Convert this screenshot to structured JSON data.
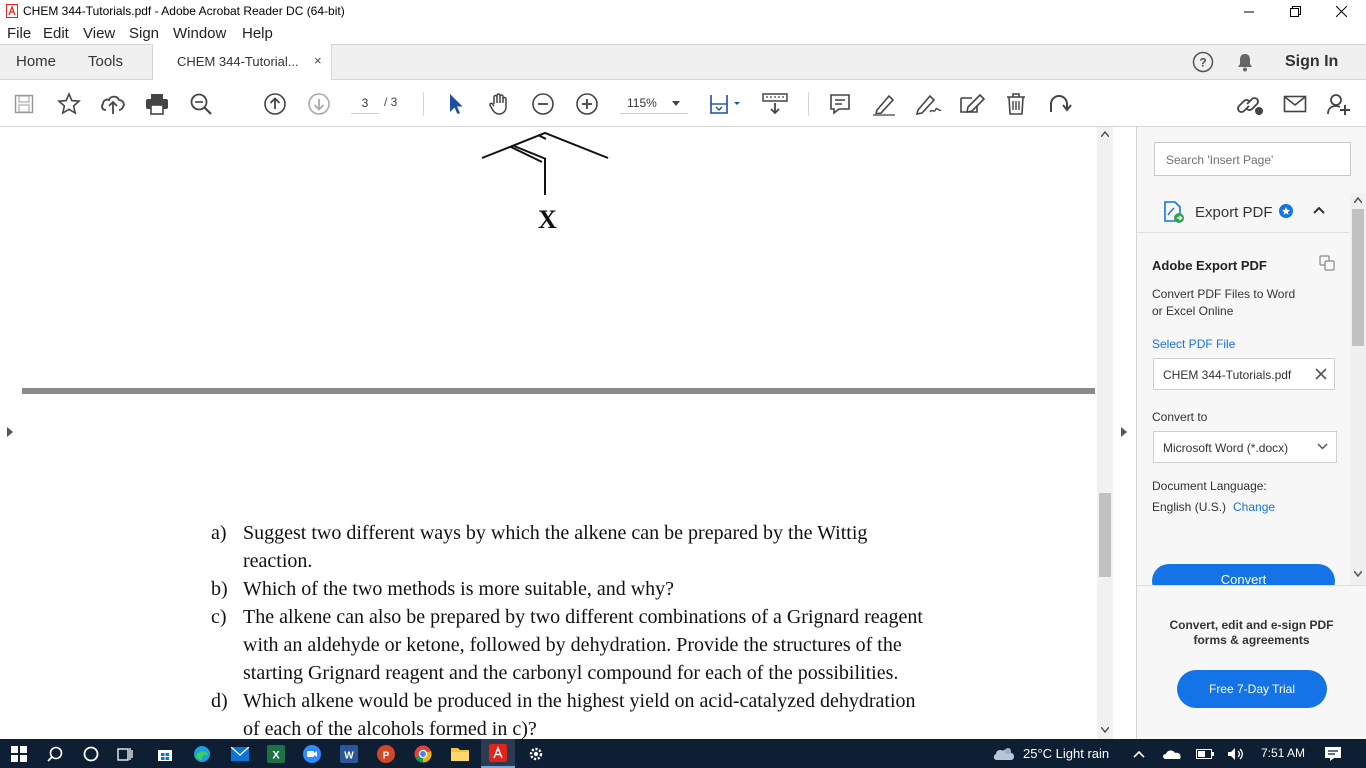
{
  "window": {
    "title": "CHEM 344-Tutorials.pdf - Adobe Acrobat Reader DC (64-bit)"
  },
  "menu": [
    "File",
    "Edit",
    "View",
    "Sign",
    "Window",
    "Help"
  ],
  "tabs": {
    "home": "Home",
    "tools": "Tools",
    "document": "CHEM 344-Tutorial...",
    "close": "×",
    "sign_in": "Sign In"
  },
  "toolbar": {
    "page_current": "3",
    "page_total": "/ 3",
    "zoom": "115%"
  },
  "document": {
    "structure_label": "X",
    "questions": [
      {
        "letter": "a)",
        "lines": [
          "Suggest two different ways by which the alkene can be prepared by the Wittig",
          "reaction."
        ]
      },
      {
        "letter": "b)",
        "lines": [
          "Which of the two methods is more suitable, and why?"
        ]
      },
      {
        "letter": "c)",
        "lines": [
          "The alkene can also be prepared by two different combinations of a Grignard reagent",
          "with an aldehyde or ketone, followed by dehydration. Provide the structures of the",
          "starting Grignard reagent and the carbonyl compound for each of the possibilities."
        ]
      },
      {
        "letter": "d)",
        "lines": [
          "Which alkene would be produced in the highest yield on acid-catalyzed dehydration",
          "of each of the alcohols formed in c)?"
        ]
      }
    ]
  },
  "panel": {
    "search_placeholder": "Search 'Insert Page'",
    "export_title": "Export PDF",
    "section_title": "Adobe Export PDF",
    "description": [
      "Convert PDF Files to Word",
      "or Excel Online"
    ],
    "select_file": "Select PDF File",
    "file_name": "CHEM 344-Tutorials.pdf",
    "convert_to_label": "Convert to",
    "convert_to_value": "Microsoft Word (*.docx)",
    "doc_language_label": "Document Language:",
    "doc_language_value": "English (U.S.)",
    "change_link": "Change",
    "convert_button": "Convert",
    "promo": [
      "Convert, edit and e-sign PDF",
      "forms & agreements"
    ],
    "trial_button": "Free 7-Day Trial"
  },
  "taskbar": {
    "weather": "25°C  Light rain",
    "time": "7:51 AM"
  },
  "colors": {
    "accent": "#1473e6",
    "taskbar": "#0f1f33",
    "acrobat_red": "#e2231a"
  }
}
